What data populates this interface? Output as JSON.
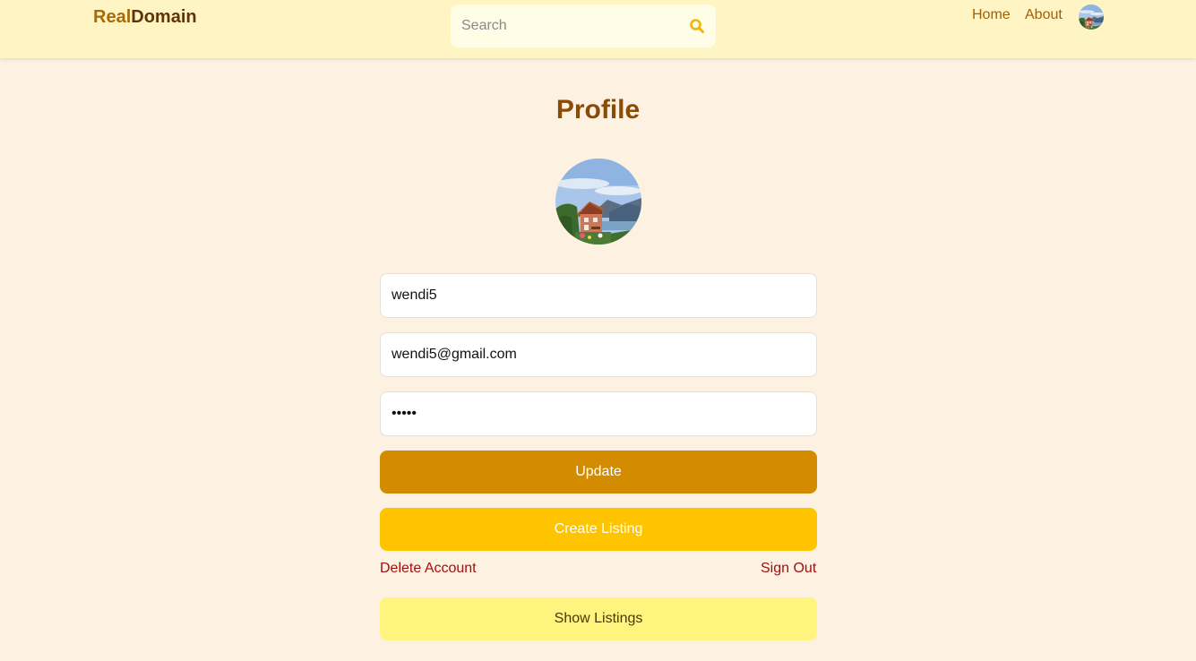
{
  "header": {
    "logo_part1": "Real",
    "logo_part2": "Domain",
    "search_placeholder": "Search",
    "search_icon": "search-icon",
    "nav_home": "Home",
    "nav_about": "About",
    "avatar": "user-avatar"
  },
  "profile": {
    "title": "Profile",
    "avatar": "profile-avatar",
    "username_value": "wendi5",
    "email_value": "wendi5@gmail.com",
    "password_value": "wendi",
    "update_label": "Update",
    "create_listing_label": "Create Listing",
    "delete_account_label": "Delete Account",
    "sign_out_label": "Sign Out",
    "show_listings_label": "Show Listings"
  },
  "colors": {
    "background": "#fdf1e1",
    "header": "#fff4c4",
    "update_button": "#d38b00",
    "create_button": "#ffc400",
    "show_listings_button": "#fff47d",
    "danger_text": "#a30f0f"
  }
}
